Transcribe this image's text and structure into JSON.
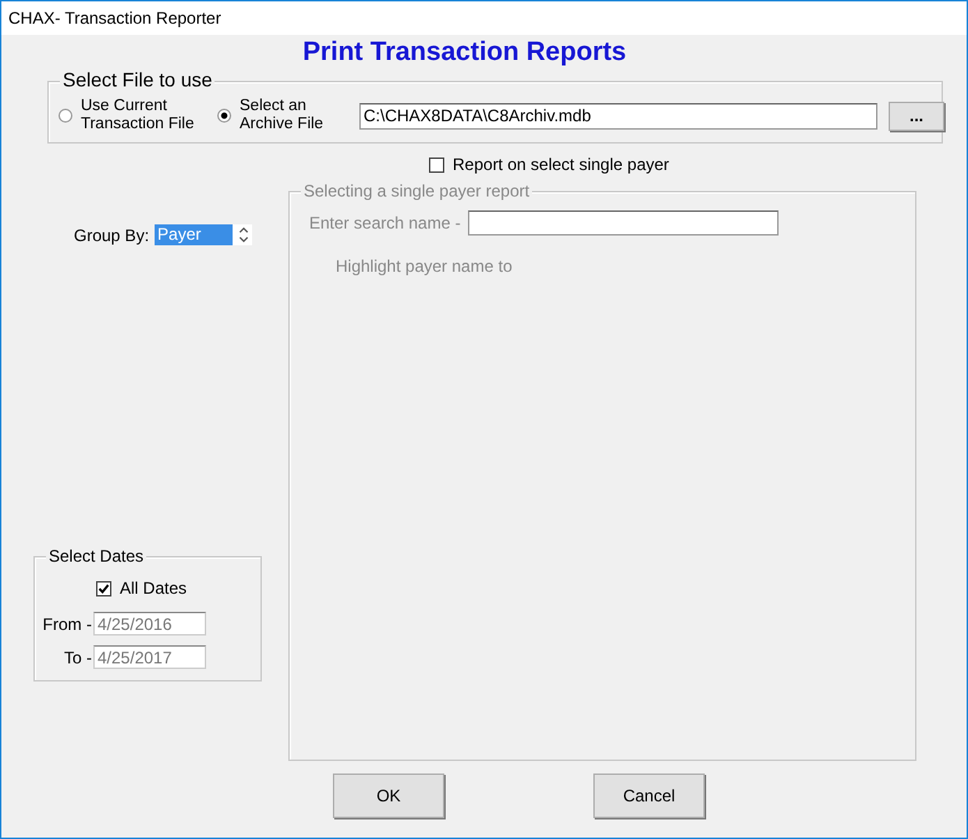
{
  "window": {
    "title": "CHAX- Transaction Reporter"
  },
  "heading": "Print Transaction Reports",
  "file_group": {
    "legend": "Select File to use",
    "options": [
      {
        "label": "Use Current Transaction File",
        "selected": false
      },
      {
        "label": "Select an Archive File",
        "selected": true
      }
    ],
    "path": "C:\\CHAX8DATA\\C8Archiv.mdb",
    "browse_button": "..."
  },
  "single_payer": {
    "label": "Report on select single payer",
    "checked": false
  },
  "group_by": {
    "label": "Group By:",
    "value": "Payer"
  },
  "payer_group": {
    "legend": "Selecting a single payer report",
    "disabled": true,
    "search_label": "Enter search name -",
    "hint": "Highlight payer name to"
  },
  "dates": {
    "legend": "Select Dates",
    "all_dates": {
      "label": "All Dates",
      "checked": true
    },
    "fields": [
      {
        "label": "From -",
        "value": "4/25/2016",
        "disabled": true
      },
      {
        "label": "To -",
        "value": "4/25/2017",
        "disabled": true
      }
    ]
  },
  "buttons": [
    "OK",
    "Cancel"
  ]
}
